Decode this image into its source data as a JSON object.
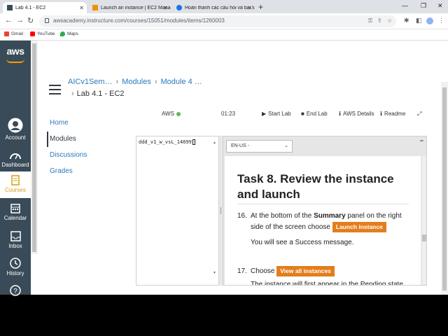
{
  "browser": {
    "tabs": [
      {
        "title": "Lab 4.1 - EC2",
        "active": true
      },
      {
        "title": "Launch an instance | EC2 Manag",
        "active": false
      },
      {
        "title": "Hoàn thành các câu hỏi và bài lu",
        "active": false
      }
    ],
    "new_tab": "+",
    "url": "awsacademy.instructure.com/courses/15051/modules/items/1260003",
    "bookmarks": [
      "Gmail",
      "YouTube",
      "Maps"
    ]
  },
  "global_nav": {
    "logo": "aws",
    "items": [
      {
        "label": "Account"
      },
      {
        "label": "Dashboard"
      },
      {
        "label": "Courses"
      },
      {
        "label": "Calendar"
      },
      {
        "label": "Inbox"
      },
      {
        "label": "History"
      }
    ]
  },
  "breadcrumbs": {
    "items": [
      "AICv1Sem…",
      "Modules",
      "Module 4 …"
    ],
    "current": "Lab 4.1 - EC2"
  },
  "course_nav": [
    "Home",
    "Modules",
    "Discussions",
    "Grades"
  ],
  "lab": {
    "aws_label": "AWS",
    "timer": "01:23",
    "start": "Start Lab",
    "end": "End Lab",
    "details": "AWS Details",
    "readme": "Readme",
    "terminal_text": "ddd_v1_w_vsL_14699",
    "language": "EN-US -",
    "task_title": "Task 8. Review the instance and launch",
    "step16_num": "16.",
    "step16_a": "At the bottom of the ",
    "step16_bold": "Summary",
    "step16_b": " panel on the right side of the screen choose ",
    "step16_button": "Launch instance",
    "step16_note": "You will see a Success message.",
    "step17_num": "17.",
    "step17_a": "Choose ",
    "step17_button": "View all instances",
    "step17_cut": "The instance will first appear in the Pending state"
  }
}
